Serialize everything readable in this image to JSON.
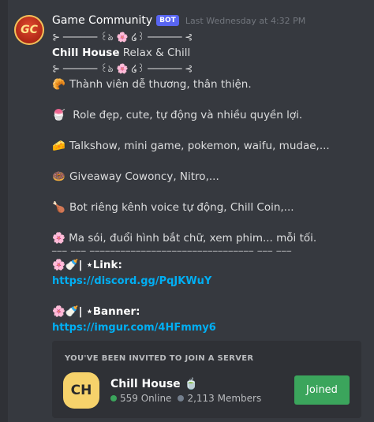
{
  "message": {
    "username": "Game Community",
    "bot_tag": "BOT",
    "timestamp": "Last Wednesday at 4:32 PM",
    "avatar_text": "GC",
    "divider_top": "⊱ ────── ꒰ঌ 🌸 ໒꒱ ────── ⊰",
    "server_title": "Chill House",
    "server_subtitle": " Relax & Chill",
    "divider_bottom": "⊱ ────── ꒰ঌ 🌸 ໒꒱ ────── ⊰",
    "features": [
      {
        "emoji": "🥐",
        "text": "Thành viên dễ thương, thân thiện."
      },
      {
        "emoji": "🍧",
        "text": " Role đẹp, cute, tự động  và nhiều quyền lợi."
      },
      {
        "emoji": "🧀",
        "text": "Talkshow, mini game, pokemon, waifu, mudae,..."
      },
      {
        "emoji": "🍩",
        "text": "Giveaway Cowoncy, Nitro,..."
      },
      {
        "emoji": "🍗",
        "text": "Bot riêng kênh voice tự động, Chill Coin,..."
      },
      {
        "emoji": "🌸",
        "text": " Ma sói, đuổi hình bắt chữ, xem phim... mỗi tối."
      }
    ],
    "underline": "___ ___ ________________________________ ___ ___",
    "link_label": "🌸🍼| ⋆Link:",
    "link_url": "https://discord.gg/PqJKWuY",
    "banner_label": "🌸🍼| ⋆Banner:",
    "banner_url": "https://imgur.com/4HFmmy6"
  },
  "invite": {
    "title": "YOU'VE BEEN INVITED TO JOIN A SERVER",
    "server_icon_text": "CH",
    "server_name": "Chill House 🍵",
    "online": "559 Online",
    "members": "2,113 Members",
    "join_label": "Joined"
  },
  "colors": {
    "background": "#36393f",
    "link": "#00aff4",
    "bot_tag": "#5865f2",
    "join_button": "#3ba55c"
  }
}
